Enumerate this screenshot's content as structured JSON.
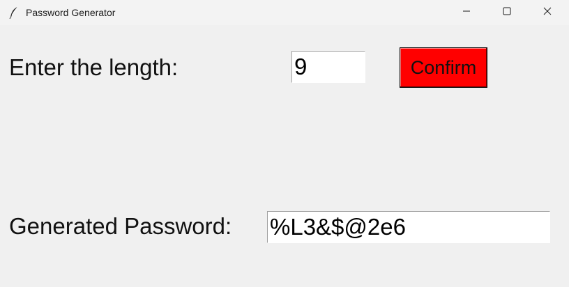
{
  "window": {
    "title": "Password Generator",
    "icon": "feather-icon",
    "controls": {
      "minimize": "minimize-icon",
      "maximize": "maximize-icon",
      "close": "close-icon"
    }
  },
  "form": {
    "length_label": "Enter the length:",
    "length_value": "9",
    "confirm_label": "Confirm",
    "confirm_color": "#ff0000",
    "password_label": "Generated Password:",
    "password_value": "%L3&$@2e6"
  }
}
